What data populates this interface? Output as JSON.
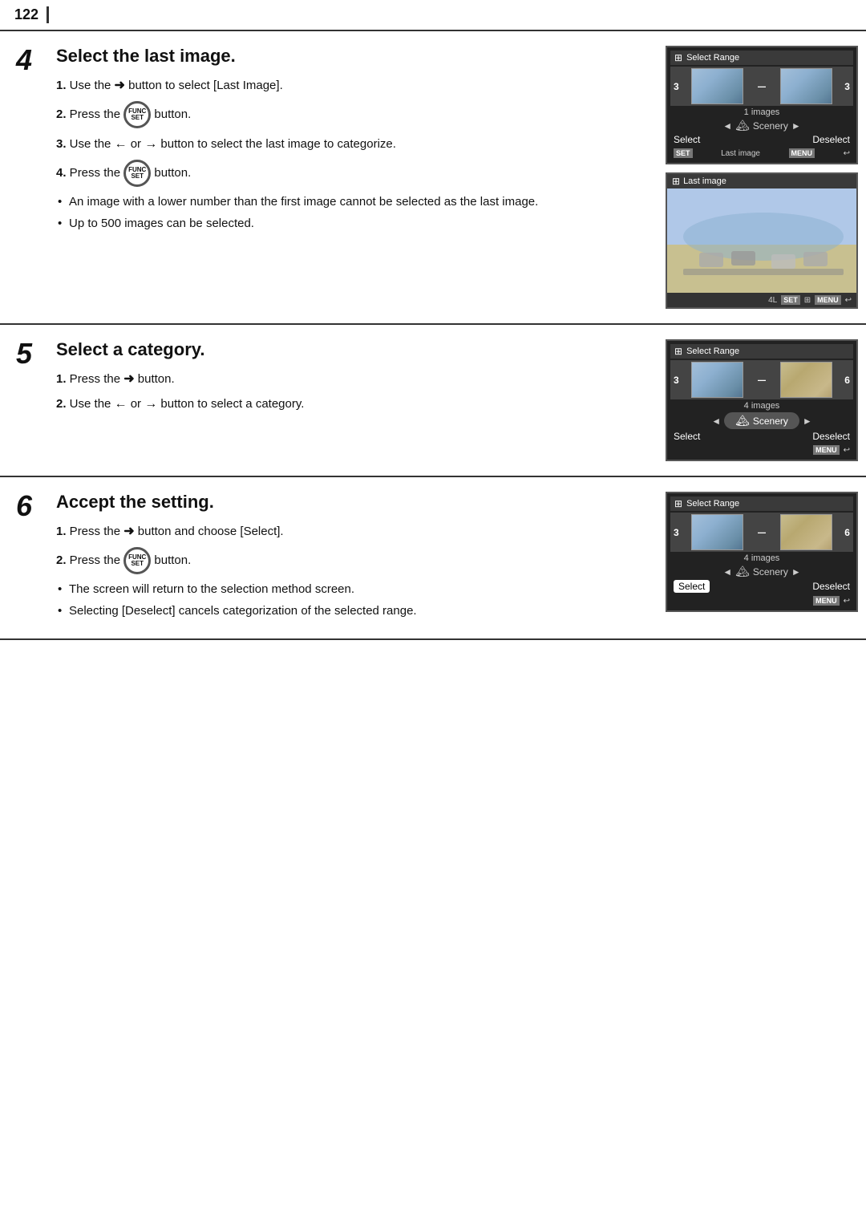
{
  "page": {
    "number": "122"
  },
  "sections": [
    {
      "id": "section-4",
      "number": "4",
      "title": "Select the last image.",
      "steps": [
        {
          "num": "1.",
          "text": "Use the ➜ button to select [Last Image]."
        },
        {
          "num": "2.",
          "text": "Press the",
          "has_func_btn": true,
          "after": "button."
        },
        {
          "num": "3.",
          "text": "Use the ← or → button to select the last image to categorize."
        },
        {
          "num": "4.",
          "text": "Press the",
          "has_func_btn": true,
          "after": "button."
        }
      ],
      "bullets": [
        "An image with a lower number than the first image cannot be selected as the last image.",
        "Up to 500 images can be selected."
      ],
      "screens": [
        {
          "type": "select-range-top",
          "title": "Select Range",
          "num_left": "3",
          "num_right": "3",
          "images_count": "1 images",
          "category_icon": "🏔",
          "category_name": "Scenery",
          "select_label": "Select",
          "deselect_label": "Deselect",
          "set_label": "SET",
          "last_image_label": "Last image",
          "menu_label": "MENU"
        },
        {
          "type": "last-image-large",
          "title": "Last image",
          "set_label": "SET",
          "menu_label": "MENU"
        }
      ]
    },
    {
      "id": "section-5",
      "number": "5",
      "title": "Select a category.",
      "steps": [
        {
          "num": "1.",
          "text": "Press the ➜ button."
        },
        {
          "num": "2.",
          "text": "Use the ← or → button to select a category."
        }
      ],
      "bullets": [],
      "screens": [
        {
          "type": "select-range-category",
          "title": "Select Range",
          "num_left": "3",
          "num_right": "6",
          "images_count": "4 images",
          "category_icon": "🏔",
          "category_name": "Scenery",
          "select_label": "Select",
          "deselect_label": "Deselect",
          "menu_label": "MENU"
        }
      ]
    },
    {
      "id": "section-6",
      "number": "6",
      "title": "Accept the setting.",
      "steps": [
        {
          "num": "1.",
          "text": "Press the ➜ button and choose [Select]."
        },
        {
          "num": "2.",
          "text": "Press the",
          "has_func_btn": true,
          "after": "button."
        }
      ],
      "bullets": [
        "The screen will return to the selection method screen.",
        "Selecting [Deselect] cancels categorization of the selected range."
      ],
      "screens": [
        {
          "type": "select-range-accept",
          "title": "Select Range",
          "num_left": "3",
          "num_right": "6",
          "images_count": "4 images",
          "category_icon": "🏔",
          "category_name": "Scenery",
          "select_label": "Select",
          "deselect_label": "Deselect",
          "menu_label": "MENU"
        }
      ]
    }
  ]
}
